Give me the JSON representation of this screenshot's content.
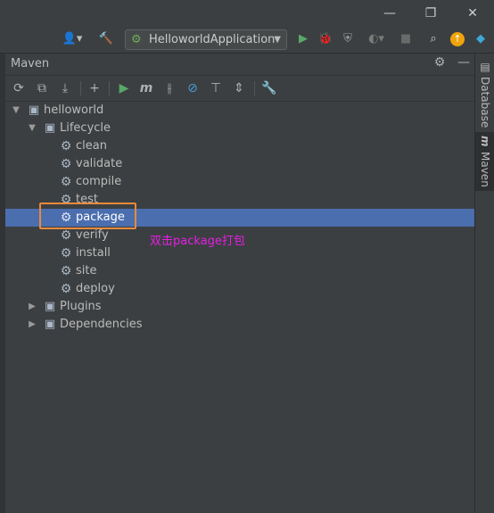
{
  "window": {
    "minimize_label": "—",
    "restore_label": "❐",
    "close_label": "✕"
  },
  "navbar": {
    "run_config": "HelloworldApplication"
  },
  "panel": {
    "title": "Maven"
  },
  "tree": {
    "project": "helloworld",
    "lifecycle": "Lifecycle",
    "phases": [
      "clean",
      "validate",
      "compile",
      "test",
      "package",
      "verify",
      "install",
      "site",
      "deploy"
    ],
    "selected_phase": "package",
    "plugins": "Plugins",
    "dependencies": "Dependencies"
  },
  "annotation": "双击package打包",
  "right_tabs": {
    "database": "Database",
    "maven": "Maven"
  },
  "colors": {
    "selection": "#4b6eaf",
    "highlight_box": "#e88a3d",
    "annotation": "#e61ee6"
  }
}
